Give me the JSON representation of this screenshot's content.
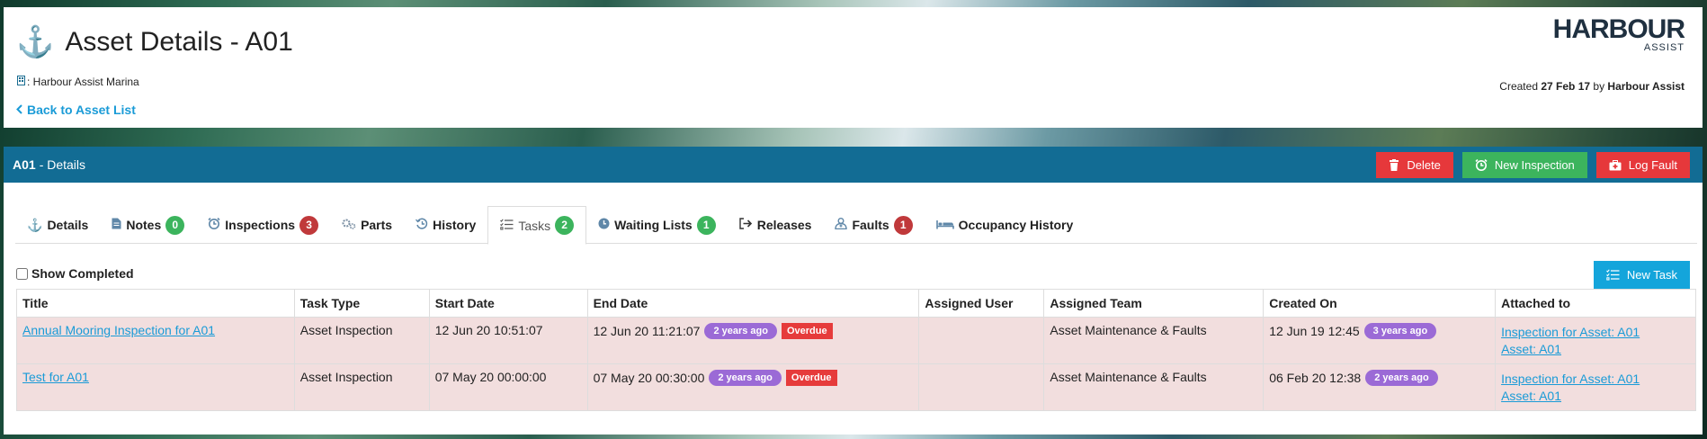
{
  "header": {
    "title": "Asset Details - A01",
    "marina": ": Harbour Assist Marina",
    "back_link": "Back to Asset List",
    "logo_main": "HARBOUR",
    "logo_sub": "ASSIST",
    "created_prefix": "Created",
    "created_date": "27 Feb 17",
    "created_by_prefix": "by",
    "created_by": "Harbour Assist"
  },
  "panel": {
    "asset_id": "A01",
    "title_suffix": "- Details",
    "buttons": {
      "delete": "Delete",
      "new_inspection": "New Inspection",
      "log_fault": "Log Fault"
    }
  },
  "tabs": [
    {
      "label": "Details",
      "icon": "anchor-icon"
    },
    {
      "label": "Notes",
      "icon": "note-icon",
      "badge": "0"
    },
    {
      "label": "Inspections",
      "icon": "inspection-icon",
      "badge": "3"
    },
    {
      "label": "Parts",
      "icon": "parts-icon"
    },
    {
      "label": "History",
      "icon": "history-icon"
    },
    {
      "label": "Tasks",
      "icon": "tasks-icon",
      "badge": "2"
    },
    {
      "label": "Waiting Lists",
      "icon": "clock-icon",
      "badge": "1"
    },
    {
      "label": "Releases",
      "icon": "release-icon"
    },
    {
      "label": "Faults",
      "icon": "faults-icon",
      "badge": "1"
    },
    {
      "label": "Occupancy History",
      "icon": "bed-icon"
    }
  ],
  "active_tab": "Tasks",
  "tasks": {
    "show_completed_label": "Show Completed",
    "new_task_label": "New Task",
    "columns": [
      "Title",
      "Task Type",
      "Start Date",
      "End Date",
      "Assigned User",
      "Assigned Team",
      "Created On",
      "Attached to"
    ],
    "rows": [
      {
        "title": "Annual Mooring Inspection for A01",
        "task_type": "Asset Inspection",
        "start_date": "12 Jun 20 10:51:07",
        "end_date": "12 Jun 20 11:21:07",
        "end_ago": "2 years ago",
        "status": "Overdue",
        "assigned_user": "",
        "assigned_team": "Asset Maintenance & Faults",
        "created_on": "12 Jun 19 12:45",
        "created_ago": "3 years ago",
        "attached_1": "Inspection for Asset: A01",
        "attached_2": "Asset: A01"
      },
      {
        "title": "Test for A01",
        "task_type": "Asset Inspection",
        "start_date": "07 May 20 00:00:00",
        "end_date": "07 May 20 00:30:00",
        "end_ago": "2 years ago",
        "status": "Overdue",
        "assigned_user": "",
        "assigned_team": "Asset Maintenance & Faults",
        "created_on": "06 Feb 20 12:38",
        "created_ago": "2 years ago",
        "attached_1": "Inspection for Asset: A01",
        "attached_2": "Asset: A01"
      }
    ]
  },
  "colors": {
    "primary": "#126c94",
    "link": "#1a9bd7",
    "danger": "#e6383b",
    "success": "#3cb45d",
    "info": "#14a5db",
    "overdue_row": "#f2dede",
    "pill": "#9b6ad6"
  }
}
